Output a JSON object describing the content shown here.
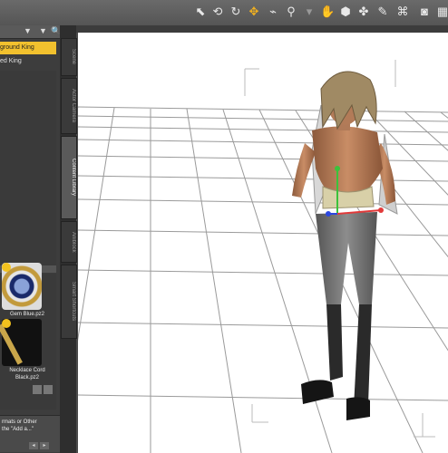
{
  "toolbar": {
    "icons": [
      "pointer-tool-icon",
      "rotate-tool-icon",
      "twist-tool-icon",
      "translate-tool-icon",
      "node-weight-icon",
      "separator",
      "active-pose-icon",
      "surface-selection-icon",
      "geometry-editor-icon",
      "joint-editor-icon",
      "camera-icon"
    ]
  },
  "scene_tree": {
    "items": [
      "ground King",
      "ed King"
    ]
  },
  "content": {
    "thumb1_label": "Gem Blue.pz2",
    "thumb2_label_line1": "Necklace Cord",
    "thumb2_label_line2": "Black.pz2"
  },
  "info": {
    "line1": "rmats or Other",
    "line2": "the \"Add a...\""
  },
  "side_tabs": [
    "Scene",
    "Actor Camera",
    "Content Library",
    "Aniblock",
    "Smart Shortcuts"
  ],
  "colors": {
    "accent": "#f2c12e",
    "panel": "#3d3d3d",
    "viewport": "#ffffff"
  }
}
